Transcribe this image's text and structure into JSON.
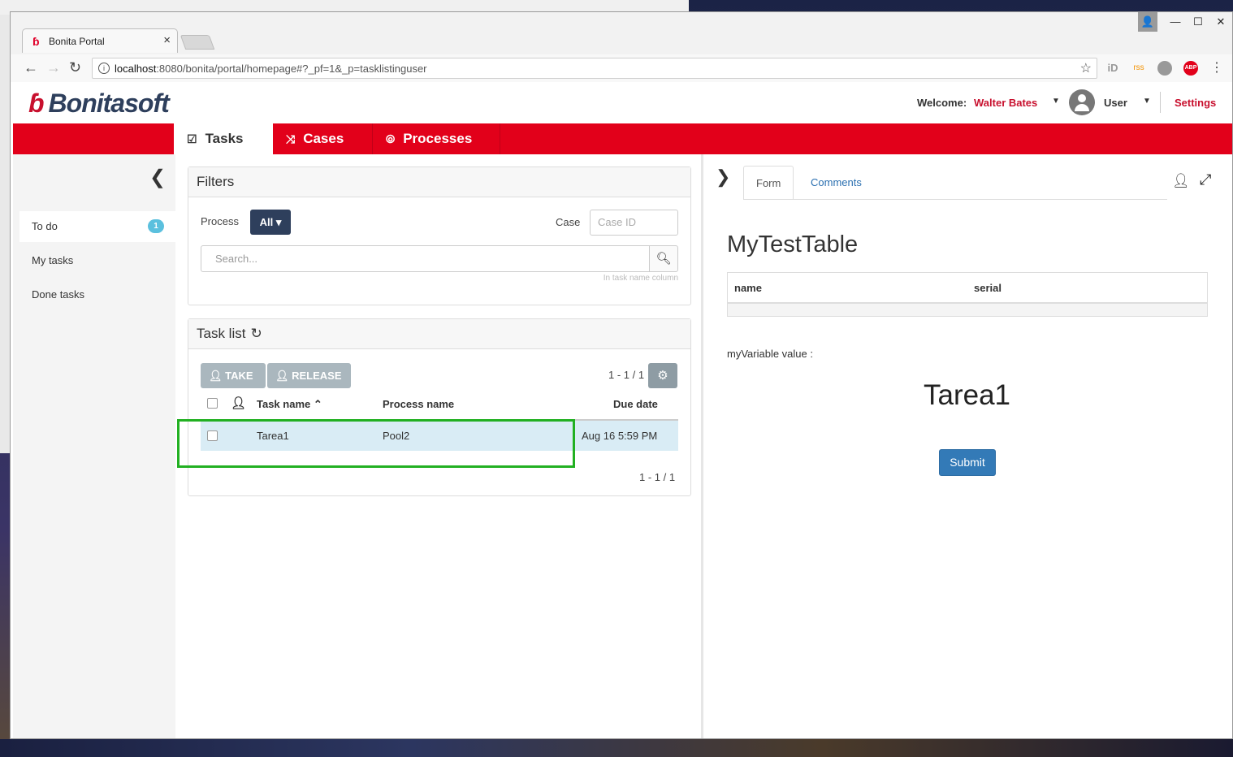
{
  "browser": {
    "tab_title": "Bonita Portal",
    "tab_close": "×",
    "url_host": "localhost",
    "url_rest": ":8080/bonita/portal/homepage#?_pf=1&_p=tasklistinguser",
    "back": "←",
    "forward": "→",
    "reload": "↻",
    "star": "☆",
    "info": "i",
    "win_user": "👤",
    "win_min": "—",
    "win_max": "☐",
    "win_close": "✕",
    "extensions": [
      "iD",
      "rss",
      "globe",
      "ABP",
      "⋮"
    ]
  },
  "header": {
    "logo_text": "Bonitasoft",
    "welcome_label": "Welcome:",
    "user_name": "Walter Bates",
    "profile": "User",
    "settings": "Settings"
  },
  "nav": {
    "tasks": "Tasks",
    "cases": "Cases",
    "processes": "Processes"
  },
  "sidebar": {
    "items": [
      {
        "label": "To do",
        "badge": "1"
      },
      {
        "label": "My tasks"
      },
      {
        "label": "Done tasks"
      }
    ]
  },
  "filters": {
    "title": "Filters",
    "process_label": "Process",
    "process_value": "All",
    "case_label": "Case",
    "case_placeholder": "Case ID",
    "search_placeholder": "Search...",
    "search_hint": "In task name column"
  },
  "tasklist": {
    "title": "Task list",
    "take": "TAKE",
    "release": "RELEASE",
    "pager": "1 - 1 / 1",
    "columns": [
      "Task name",
      "Process name",
      "Due date"
    ],
    "rows": [
      {
        "task": "Tarea1",
        "process": "Pool2",
        "due": "Aug 16 5:59 PM"
      }
    ]
  },
  "rightpane": {
    "tabs": [
      "Form",
      "Comments"
    ],
    "form_title": "MyTestTable",
    "table_columns": [
      "name",
      "serial"
    ],
    "variable_label": "myVariable value :",
    "task_name": "Tarea1",
    "submit": "Submit"
  },
  "colors": {
    "brand_red": "#e2001a",
    "nav_dark": "#2e3f5c",
    "highlight": "#22b022",
    "link_blue": "#2a6fb0"
  }
}
